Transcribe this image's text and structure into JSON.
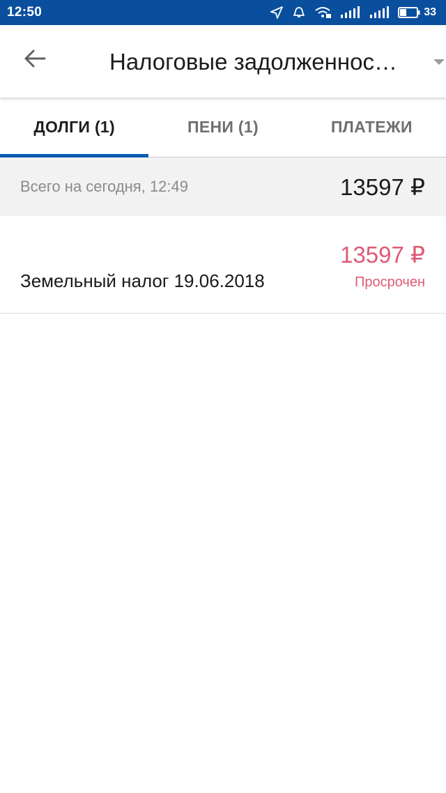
{
  "status_bar": {
    "time": "12:50",
    "battery_level": "33",
    "icons": [
      "location-arrow-icon",
      "alarm-icon",
      "wifi-icon",
      "signal-icon",
      "signal-icon",
      "battery-icon"
    ]
  },
  "app_bar": {
    "title": "Налоговые задолженнос…",
    "back_icon": "arrow-left-icon",
    "dropdown_icon": "caret-down-icon"
  },
  "tabs": [
    {
      "label": "ДОЛГИ (1)",
      "active": true
    },
    {
      "label": "ПЕНИ (1)",
      "active": false
    },
    {
      "label": "ПЛАТЕЖИ",
      "active": false
    }
  ],
  "summary": {
    "label": "Всего на сегодня, 12:49",
    "amount": "13597 ₽"
  },
  "debts": [
    {
      "name": "Земельный налог 19.06.2018",
      "amount": "13597 ₽",
      "status": "Просрочен"
    }
  ],
  "colors": {
    "status_bar": "#0a4f9e",
    "tab_indicator": "#0a5cae",
    "overdue": "#de5a74",
    "summary_bg": "#f2f2f2"
  }
}
